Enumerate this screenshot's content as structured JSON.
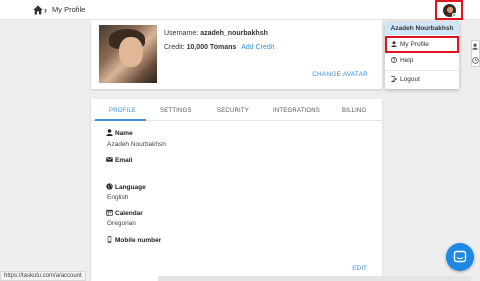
{
  "breadcrumb": {
    "home_icon": "home-icon",
    "separator": "›",
    "current": "My Profile"
  },
  "profile": {
    "username_label": "Username:",
    "username_value": "azadeh_nourbakhsh",
    "credit_label": "Credit:",
    "credit_value": "10,000 Tomans",
    "add_credit": "Add Credit",
    "change_avatar": "CHANGE AVATAR"
  },
  "tabs": [
    {
      "label": "PROFILE",
      "active": true
    },
    {
      "label": "SETTINGS",
      "active": false
    },
    {
      "label": "SECURITY",
      "active": false
    },
    {
      "label": "INTEGRATIONS",
      "active": false
    },
    {
      "label": "BILLING",
      "active": false
    }
  ],
  "fields": [
    {
      "label": "Name",
      "value": "Azadeh Nourbakhsh",
      "icon": "person-icon"
    },
    {
      "label": "Email",
      "value": "",
      "icon": "email-icon"
    },
    {
      "label": "Language",
      "value": "English",
      "icon": "globe-icon"
    },
    {
      "label": "Calendar",
      "value": "Gregorian",
      "icon": "calendar-icon"
    },
    {
      "label": "Mobile number",
      "value": "",
      "icon": "phone-icon"
    }
  ],
  "edit_label": "EDIT",
  "dropdown": {
    "header": "Azadeh Nourbakhsh",
    "items": [
      {
        "label": "My Profile",
        "icon": "person-icon"
      },
      {
        "label": "Help",
        "icon": "help-icon"
      },
      {
        "label": "Logout",
        "icon": "logout-icon"
      }
    ]
  },
  "status_url": "https://taskulu.com/a/account",
  "colors": {
    "accent": "#3d8fd9",
    "highlight": "#e0141e",
    "fab": "#1e88e5",
    "dropdown_header": "#cfe6f7"
  }
}
